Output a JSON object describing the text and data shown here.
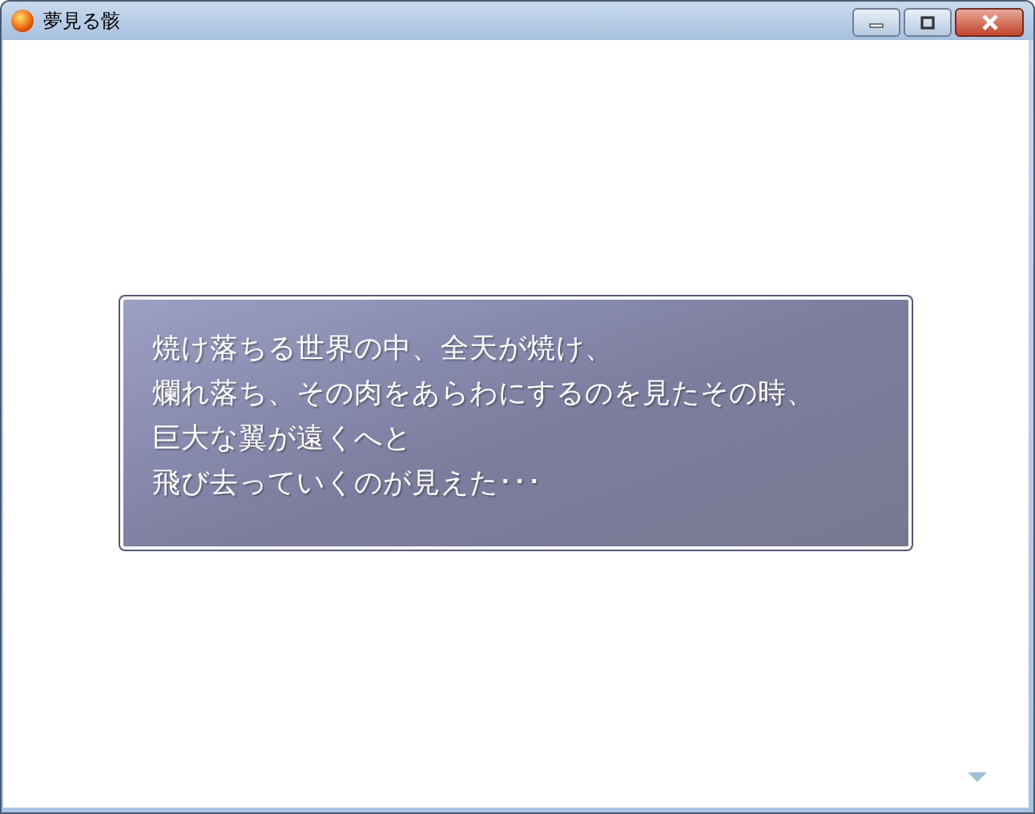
{
  "window": {
    "title": "夢見る骸"
  },
  "message": {
    "lines": [
      "焼け落ちる世界の中、全天が焼け、",
      "爛れ落ち、その肉をあらわにするのを見たその時、",
      "巨大な翼が遠くへと",
      "飛び去っていくのが見えた･･･"
    ]
  }
}
